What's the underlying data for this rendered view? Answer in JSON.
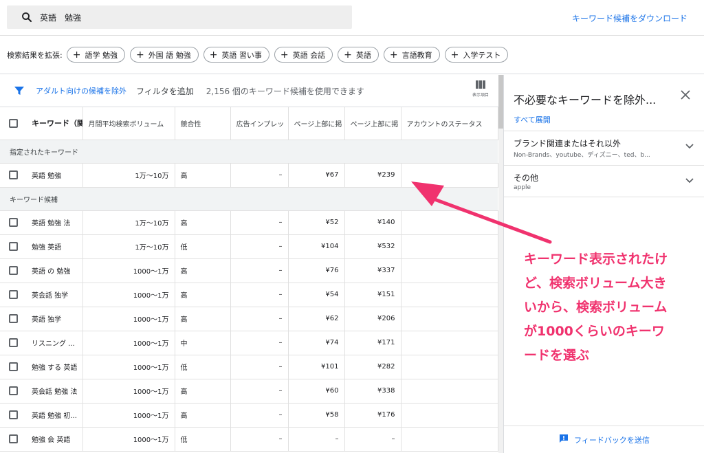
{
  "search": {
    "query": "英語　勉強"
  },
  "header": {
    "download_label": "キーワード候補をダウンロード"
  },
  "expand": {
    "label": "検索結果を拡張:",
    "chips": [
      "語学 勉強",
      "外国 語 勉強",
      "英語 習い事",
      "英語 会話",
      "英語",
      "言語教育",
      "入学テスト"
    ]
  },
  "toolbar": {
    "exclude_adult": "アダルト向けの候補を除外",
    "add_filter": "フィルタを追加",
    "count_text": "2,156 個のキーワード候補を使用できます",
    "columns_label": "表示項目"
  },
  "table": {
    "headers": [
      "キーワード（関",
      "月間平均検索ボリューム",
      "競合性",
      "広告インプレッ",
      "ページ上部に掲",
      "ページ上部に掲",
      "アカウントのステータス"
    ],
    "section_specified": "指定されたキーワード",
    "section_candidates": "キーワード候補",
    "specified_rows": [
      {
        "keyword": "英語 勉強",
        "volume": "1万～10万",
        "competition": "高",
        "impr": "–",
        "low": "¥67",
        "high": "¥239",
        "status": ""
      }
    ],
    "candidate_rows": [
      {
        "keyword": "英語 勉強 法",
        "volume": "1万～10万",
        "competition": "高",
        "impr": "–",
        "low": "¥52",
        "high": "¥140",
        "status": ""
      },
      {
        "keyword": "勉強 英語",
        "volume": "1万～10万",
        "competition": "低",
        "impr": "–",
        "low": "¥104",
        "high": "¥532",
        "status": ""
      },
      {
        "keyword": "英語 の 勉強",
        "volume": "1000～1万",
        "competition": "高",
        "impr": "–",
        "low": "¥76",
        "high": "¥337",
        "status": ""
      },
      {
        "keyword": "英会話 独学",
        "volume": "1000～1万",
        "competition": "高",
        "impr": "–",
        "low": "¥54",
        "high": "¥151",
        "status": ""
      },
      {
        "keyword": "英語 独学",
        "volume": "1000～1万",
        "competition": "高",
        "impr": "–",
        "low": "¥62",
        "high": "¥206",
        "status": ""
      },
      {
        "keyword": "リスニング ...",
        "volume": "1000～1万",
        "competition": "中",
        "impr": "–",
        "low": "¥74",
        "high": "¥171",
        "status": ""
      },
      {
        "keyword": "勉強 する 英語",
        "volume": "1000～1万",
        "competition": "低",
        "impr": "–",
        "low": "¥101",
        "high": "¥282",
        "status": ""
      },
      {
        "keyword": "英会話 勉強 法",
        "volume": "1000～1万",
        "competition": "高",
        "impr": "–",
        "low": "¥60",
        "high": "¥338",
        "status": ""
      },
      {
        "keyword": "英語 勉強 初...",
        "volume": "1000～1万",
        "competition": "高",
        "impr": "–",
        "low": "¥58",
        "high": "¥176",
        "status": ""
      },
      {
        "keyword": "勉強 会 英語",
        "volume": "1000～1万",
        "competition": "低",
        "impr": "–",
        "low": "–",
        "high": "–",
        "status": ""
      }
    ]
  },
  "panel": {
    "title": "不必要なキーワードを除外...",
    "expand_all": "すべて展開",
    "groups": [
      {
        "title": "ブランド関連またはそれ以外",
        "sub": "Non-Brands、youtube、ディズニー、ted、b..."
      },
      {
        "title": "その他",
        "sub": "apple"
      }
    ],
    "feedback": "フィードバックを送信"
  },
  "annotation": {
    "lines": [
      "キーワード表示されたけ",
      "ど、検索ボリューム大き",
      "いから、検索ボリューム",
      "が1000くらいのキーワ",
      "ードを選ぶ"
    ],
    "color": "#f0326e"
  },
  "colors": {
    "accent": "#1a73e8"
  }
}
